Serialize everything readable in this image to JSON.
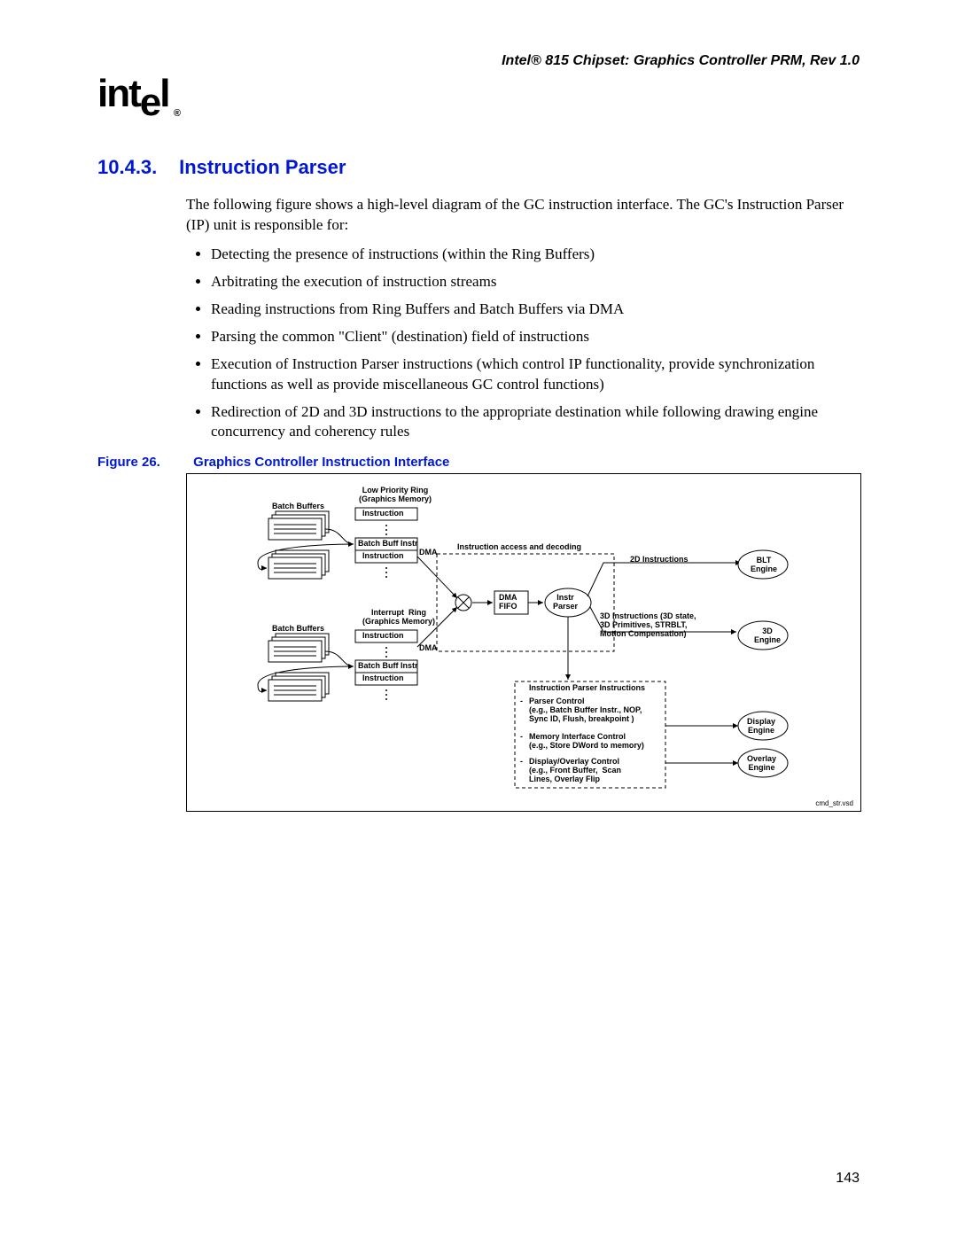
{
  "header": {
    "running_title": "Intel® 815 Chipset: Graphics Controller PRM, Rev 1.0",
    "logo_text": "intel",
    "logo_sub": "®"
  },
  "section": {
    "number": "10.4.3.",
    "title": "Instruction Parser",
    "intro": "The following figure shows a high-level diagram of the GC instruction interface. The GC's Instruction Parser (IP) unit is responsible for:",
    "bullets": [
      "Detecting the presence of instructions (within the Ring Buffers)",
      "Arbitrating the execution of instruction streams",
      "Reading instructions from Ring Buffers and Batch Buffers via DMA",
      "Parsing the common \"Client\" (destination) field of instructions",
      "Execution of Instruction Parser instructions (which control IP functionality, provide synchronization functions as well as provide miscellaneous GC control functions)",
      "Redirection of 2D and 3D instructions to the appropriate destination while following drawing engine concurrency and coherency rules"
    ]
  },
  "figure": {
    "number": "Figure 26.",
    "title": "Graphics Controller Instruction Interface",
    "labels": {
      "low_priority": "Low Priority Ring\n(Graphics Memory)",
      "interrupt_ring": "Interrupt  Ring\n(Graphics Memory)",
      "batch_buffers": "Batch Buffers",
      "instruction": "Instruction",
      "batch_buff_instr": "Batch Buff Instr",
      "dma": "DMA",
      "dma_fifo": "DMA\nFIFO",
      "instr_parser": "Instr\nParser",
      "access_decode": "Instruction access and decoding",
      "two_d": "2D Instructions",
      "three_d": "3D Instructions (3D state,\n3D Primitives, STRBLT,\nMotion Compensation)",
      "parser_instr_title": "Instruction Parser Instructions",
      "parser_control": "Parser Control\n(e.g., Batch Buffer Instr., NOP,\nSync ID, Flush, breakpoint )",
      "mem_iface": "Memory Interface Control\n(e.g., Store DWord to memory)",
      "disp_overlay": "Display/Overlay Control\n(e.g., Front Buffer,  Scan\nLines, Overlay Flip",
      "blt_engine": "BLT\nEngine",
      "three_d_engine": "3D\nEngine",
      "display_engine": "Display\nEngine",
      "overlay_engine": "Overlay\nEngine",
      "footer": "cmd_str.vsd",
      "dash_item": "-"
    }
  },
  "page_number": "143"
}
